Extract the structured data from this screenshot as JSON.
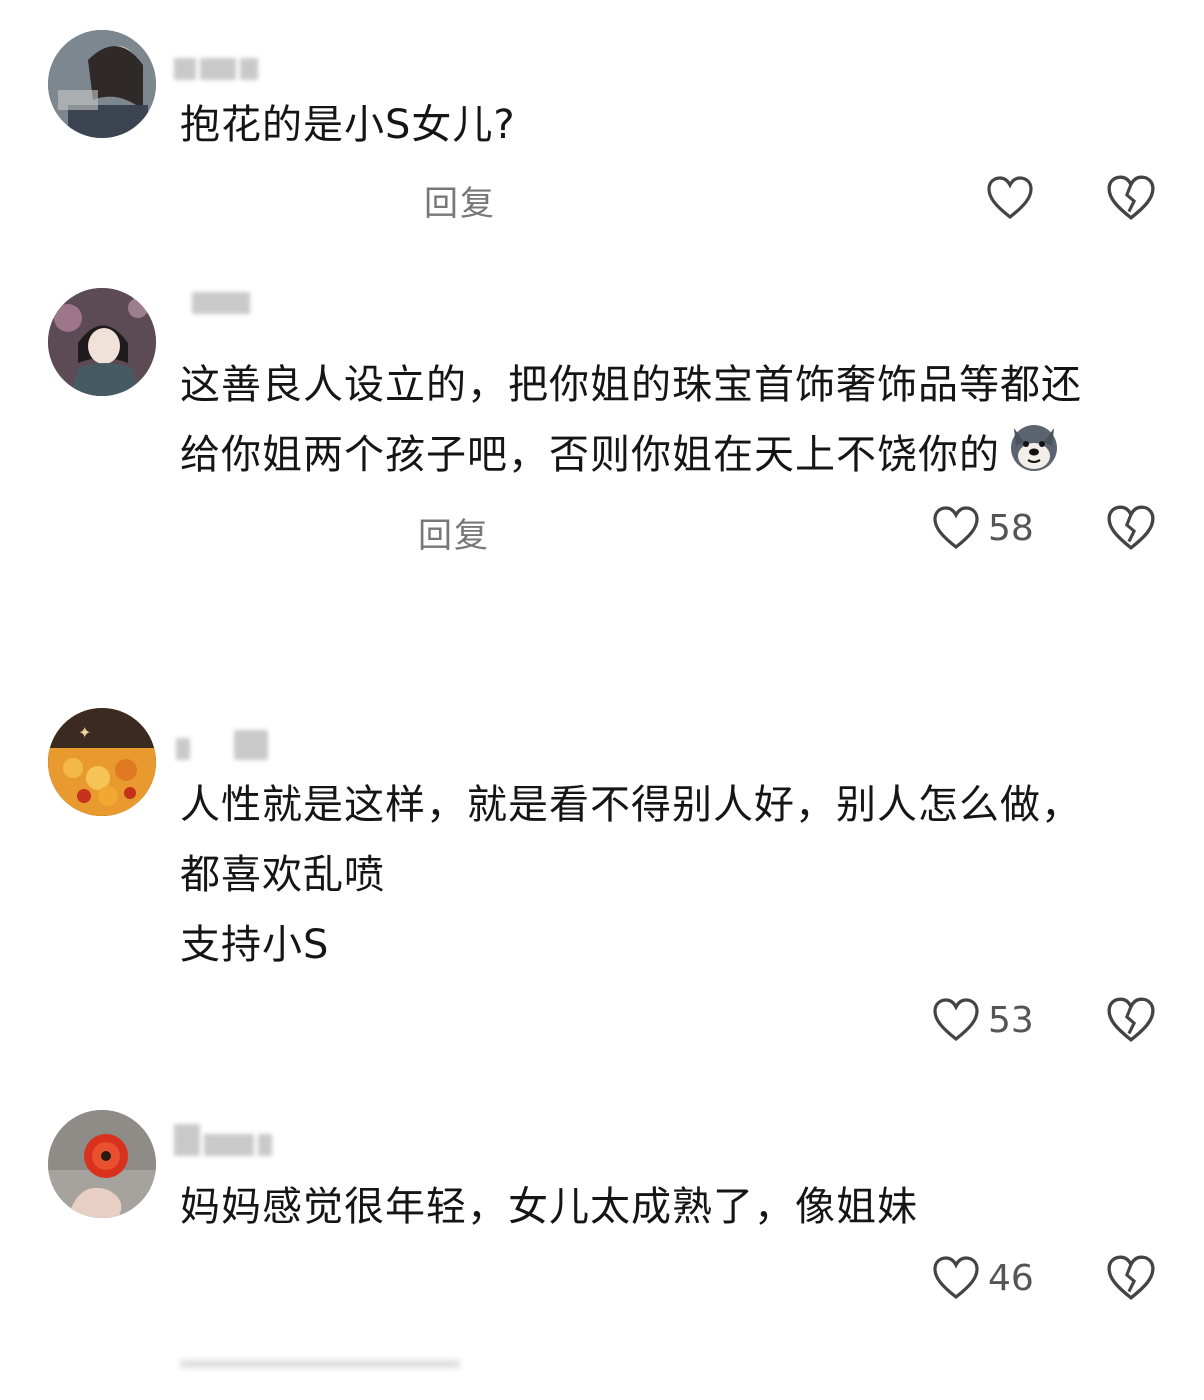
{
  "comments": [
    {
      "text_lines": [
        "抱花的是小S女儿?"
      ],
      "reply_label": "回复",
      "like_count": "",
      "colors": {
        "avatar_bg": "#5a6470",
        "avatar_fg": "#d9d2c8"
      }
    },
    {
      "text_lines": [
        "这善良人设立的，把你姐的珠宝首饰奢饰品等都还",
        "给你姐两个孩子吧，否则你姐在天上不饶你的"
      ],
      "reply_label": "回复",
      "like_count": "58",
      "emoji": "dog-emoji",
      "colors": {
        "avatar_bg": "#6b5a5e",
        "avatar_fg": "#2b2b2b"
      }
    },
    {
      "text_lines": [
        "人性就是这样，就是看不得别人好，别人怎么做，",
        "都喜欢乱喷",
        "支持小S"
      ],
      "reply_label": "",
      "like_count": "53",
      "colors": {
        "avatar_bg": "#e8a23a",
        "avatar_fg": "#c4321c"
      }
    },
    {
      "text_lines": [
        "妈妈感觉很年轻，女儿太成熟了，像姐妹"
      ],
      "reply_label": "",
      "like_count": "46",
      "colors": {
        "avatar_bg": "#9c9c9c",
        "avatar_fg": "#d8321e"
      }
    }
  ],
  "icons": {
    "like": "heart-outline-icon",
    "dislike": "broken-heart-icon"
  }
}
